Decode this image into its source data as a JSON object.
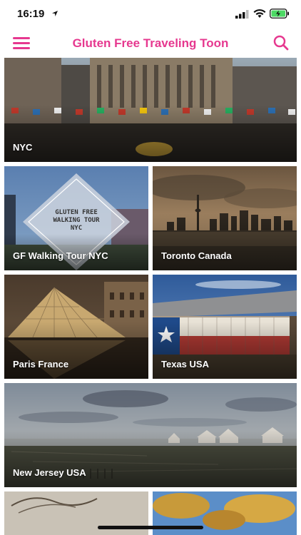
{
  "status_bar": {
    "time": "16:19"
  },
  "header": {
    "title": "Gluten Free Traveling Toon",
    "accent_color": "#e6388f",
    "menu_icon": "hamburger-icon",
    "search_icon": "search-icon"
  },
  "tiles": [
    {
      "label": "NYC"
    },
    {
      "label": "GF Walking Tour NYC",
      "badge_lines": [
        "GLUTEN FREE",
        "WALKING TOUR",
        "NYC"
      ]
    },
    {
      "label": "Toronto Canada"
    },
    {
      "label": "Paris France"
    },
    {
      "label": "Texas USA"
    },
    {
      "label": "New Jersey USA"
    }
  ]
}
